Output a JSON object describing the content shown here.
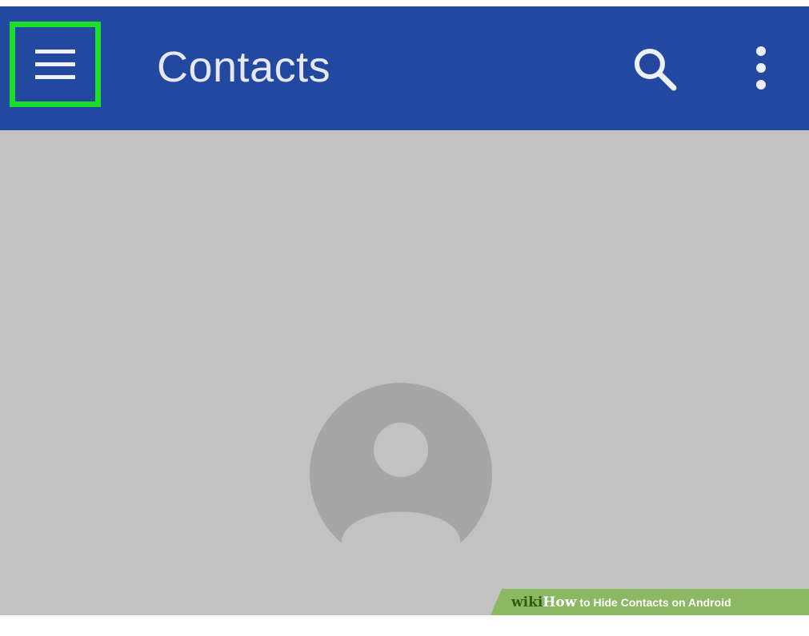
{
  "app_bar": {
    "title": "Contacts",
    "background_color": "#2348a0",
    "menu_icon": "hamburger-menu-icon",
    "search_icon": "search-icon",
    "overflow_icon": "more-vert-icon",
    "highlight_color": "#1cdc2c"
  },
  "content": {
    "background_color": "#c2c2c2",
    "avatar_icon": "default-contact-avatar-icon"
  },
  "watermark": {
    "wiki": "wiki",
    "how": "How",
    "caption": "to Hide Contacts on Android",
    "background_color": "#8cb864"
  }
}
